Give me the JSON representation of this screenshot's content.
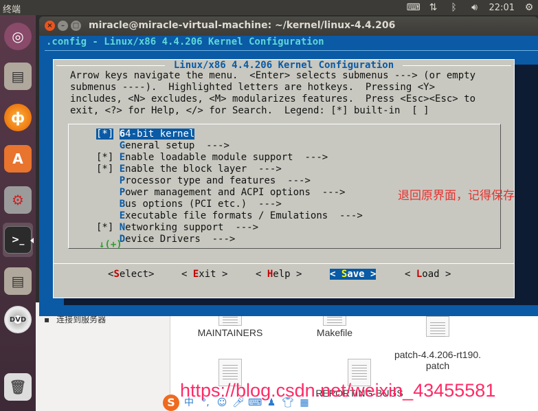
{
  "top_panel": {
    "app_name": "终端",
    "clock": "22:01",
    "tray_icons": [
      "keyboard-icon",
      "network-icon",
      "bluetooth-icon",
      "volume-icon",
      "gear-icon"
    ]
  },
  "launcher": {
    "items": [
      "ubuntu-dash-icon",
      "files-icon",
      "firefox-icon",
      "software-center-icon",
      "system-settings-icon",
      "terminal-icon",
      "files-icon",
      "dvd-icon",
      "trash-icon"
    ]
  },
  "terminal": {
    "title": "miracle@miracle-virtual-machine: ~/kernel/linux-4.4.206",
    "config_header": ".config - Linux/x86 4.4.206 Kernel Configuration"
  },
  "dialog": {
    "title": " Linux/x86 4.4.206 Kernel Configuration ",
    "help_lines": [
      "Arrow keys navigate the menu.  <Enter> selects submenus ---> (or empty",
      "submenus ----).  Highlighted letters are hotkeys.  Pressing <Y>",
      "includes, <N> excludes, <M> modularizes features.  Press <Esc><Esc> to",
      "exit, <?> for Help, </> for Search.  Legend: [*] built-in  [ ]"
    ],
    "menu_items": [
      {
        "mark": "[*]",
        "hot": "6",
        "rest": "4-bit kernel",
        "selected": true
      },
      {
        "mark": "   ",
        "hot": "G",
        "rest": "eneral setup  --->",
        "selected": false
      },
      {
        "mark": "[*]",
        "hot": "E",
        "rest": "nable loadable module support  --->",
        "selected": false
      },
      {
        "mark": "[*]",
        "hot": "E",
        "rest": "nable the block layer  --->",
        "selected": false
      },
      {
        "mark": "   ",
        "hot": "P",
        "rest": "rocessor type and features  --->",
        "selected": false
      },
      {
        "mark": "   ",
        "hot": "P",
        "rest": "ower management and ACPI options  --->",
        "selected": false
      },
      {
        "mark": "   ",
        "hot": "B",
        "rest": "us options (PCI etc.)  --->",
        "selected": false
      },
      {
        "mark": "   ",
        "hot": "E",
        "rest": "xecutable file formats / Emulations  --->",
        "selected": false
      },
      {
        "mark": "[*]",
        "hot": "N",
        "rest": "etworking support  --->",
        "selected": false
      },
      {
        "mark": "   ",
        "hot": "D",
        "rest": "evice Drivers  --->",
        "selected": false
      }
    ],
    "more_indicator": "↓(+)",
    "buttons": [
      {
        "pre": "<",
        "hot": "S",
        "rest": "elect>",
        "active": false
      },
      {
        "pre": "< ",
        "hot": "E",
        "rest": "xit >",
        "active": false
      },
      {
        "pre": "< ",
        "hot": "H",
        "rest": "elp >",
        "active": false
      },
      {
        "pre": "< ",
        "hot": "S",
        "rest": "ave >",
        "active": true
      },
      {
        "pre": "< ",
        "hot": "L",
        "rest": "oad >",
        "active": false
      }
    ]
  },
  "annotation": "退回原界面，记得保存",
  "file_manager": {
    "sidebar_item": "连接到服务器",
    "files": [
      "MAINTAINERS",
      "Makefile",
      "patch-4.4.206-rt190.\npatch",
      "REPORTING-BUGS"
    ]
  },
  "watermark": "https://blog.csdn.net/weixin_43455581",
  "ime_bar": {
    "logo": "S",
    "lang": "中"
  }
}
